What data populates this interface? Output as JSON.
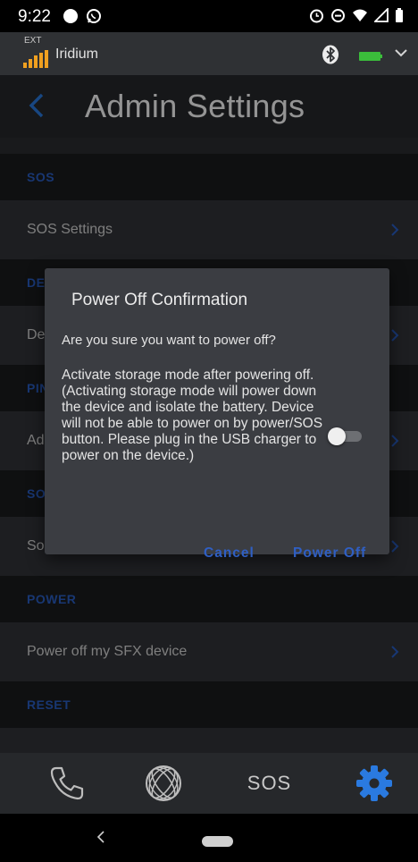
{
  "status_bar": {
    "time": "9:22",
    "icons_left": [
      "circle-icon",
      "whatsapp-icon"
    ],
    "icons_right": [
      "alarm-icon",
      "do-not-disturb-icon",
      "wifi-icon",
      "signal-icon",
      "battery-icon"
    ]
  },
  "satellite_bar": {
    "ext_label": "EXT",
    "network_name": "Iridium",
    "icons": [
      "signal-bars-icon",
      "bluetooth-icon",
      "battery-icon",
      "chevron-down-icon"
    ],
    "accent_color": "#f0a020",
    "battery_color": "#3bbd3b"
  },
  "header": {
    "title": "Admin Settings",
    "accent_color": "#2a7ae0"
  },
  "sections": [
    {
      "header": "SOS",
      "row": "SOS Settings"
    },
    {
      "header": "DE",
      "row": "De"
    },
    {
      "header": "PIN",
      "row": "Ad"
    },
    {
      "header": "SO",
      "row": "So"
    },
    {
      "header": "POWER",
      "row": "Power off my SFX device"
    },
    {
      "header": "RESET",
      "row": ""
    }
  ],
  "dialog": {
    "title": "Power Off Confirmation",
    "question": "Are you sure you want to power off?",
    "storage_text": "Activate storage mode after powering off.\n(Activating storage mode will power down the device and isolate the battery. Device will not be able to power on by power/SOS button. Please plug in the USB charger to power on the device.)",
    "storage_mode_enabled": false,
    "cancel_label": "Cancel",
    "power_off_label": "Power Off",
    "button_color": "#2f5fc4"
  },
  "tabbar": {
    "tabs": [
      "phone-icon",
      "globe-icon",
      "SOS",
      "gear-icon"
    ],
    "sos_label": "SOS",
    "active_tab": "settings",
    "active_color": "#2a7ae0"
  },
  "navbar": {
    "icons": [
      "back-icon",
      "home-pill"
    ]
  }
}
